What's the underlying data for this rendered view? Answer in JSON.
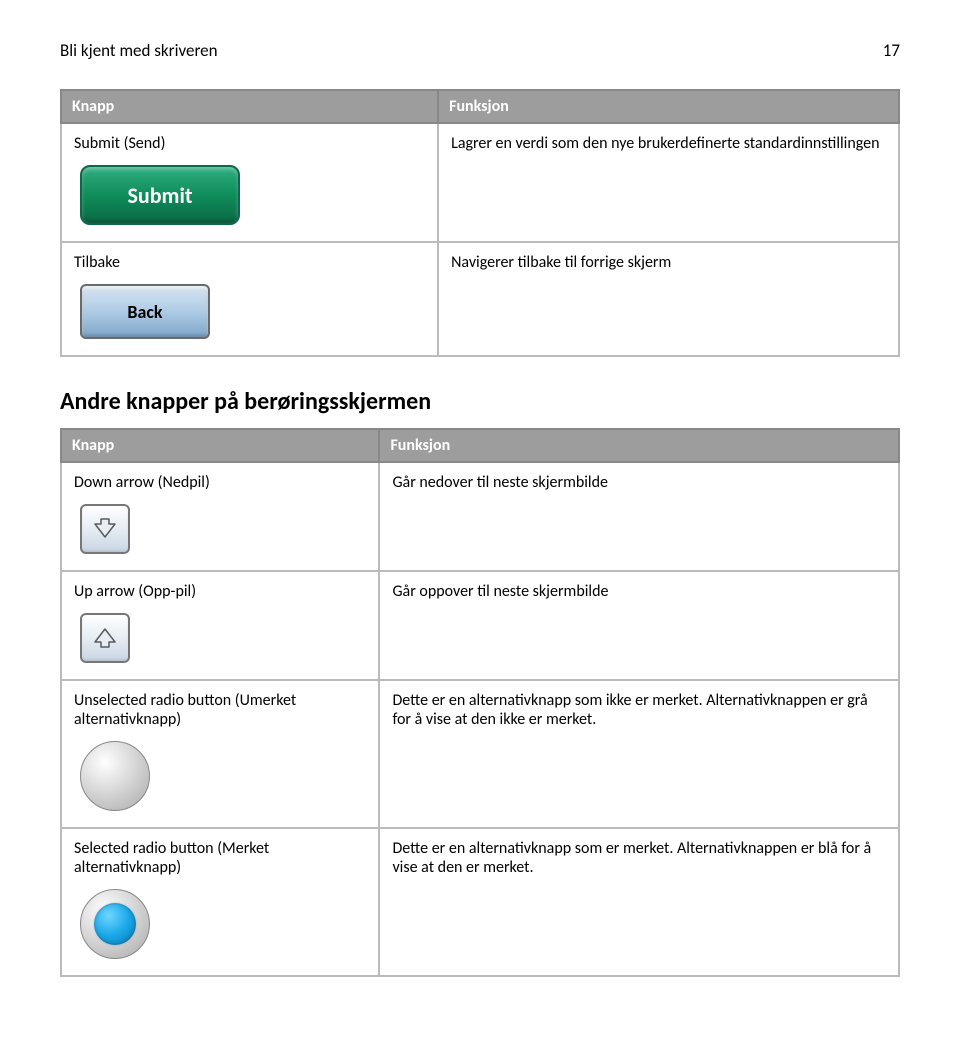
{
  "header": {
    "title": "Bli kjent med skriveren",
    "page_number": "17"
  },
  "table1": {
    "th_knapp": "Knapp",
    "th_funksjon": "Funksjon",
    "rows": [
      {
        "label": "Submit (Send)",
        "desc": "Lagrer en verdi som den nye brukerdefinerte standardinnstillingen",
        "btn_text": "Submit"
      },
      {
        "label": "Tilbake",
        "desc": "Navigerer tilbake til forrige skjerm",
        "btn_text": "Back"
      }
    ]
  },
  "section_title": "Andre knapper på berøringsskjermen",
  "table2": {
    "th_knapp": "Knapp",
    "th_funksjon": "Funksjon",
    "rows": [
      {
        "label": "Down arrow (Nedpil)",
        "desc": "Går nedover til neste skjermbilde"
      },
      {
        "label": "Up arrow (Opp-pil)",
        "desc": "Går oppover til neste skjermbilde"
      },
      {
        "label": "Unselected radio button (Umerket alternativknapp)",
        "desc": "Dette er en alternativknapp som ikke er merket. Alternativknappen er grå for å vise at den ikke er merket."
      },
      {
        "label": "Selected radio button (Merket alternativknapp)",
        "desc": "Dette er en alternativknapp som er merket. Alternativknappen er blå for å vise at den er merket."
      }
    ]
  }
}
